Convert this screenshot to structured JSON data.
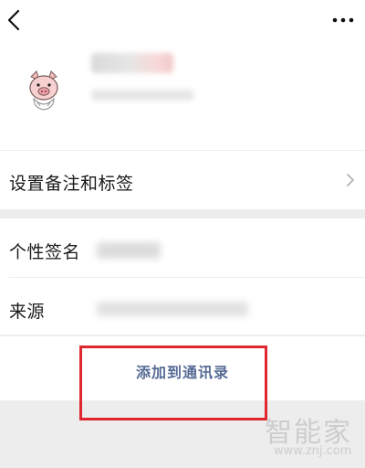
{
  "nav": {
    "back_icon": "chevron-left-icon",
    "more_icon": "more-dots-icon"
  },
  "profile": {
    "avatar_icon": "pig-avatar-icon"
  },
  "settings_row": {
    "label": "设置备注和标签",
    "chevron_icon": "chevron-right-icon"
  },
  "info_rows": [
    {
      "label": "个性签名"
    },
    {
      "label": "来源"
    }
  ],
  "action": {
    "add_contact_label": "添加到通讯录"
  },
  "watermark": {
    "brand": "智能家",
    "url": "www.znj.com"
  },
  "colors": {
    "link_blue": "#576b95",
    "highlight_red": "#e0262e",
    "gap_gray": "#ededed"
  }
}
